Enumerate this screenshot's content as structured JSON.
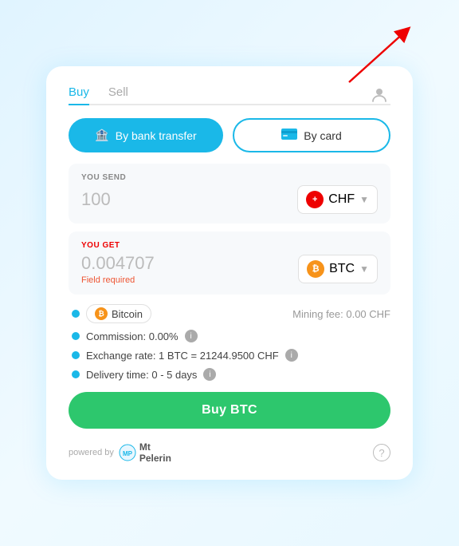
{
  "tabs": {
    "buy_label": "Buy",
    "sell_label": "Sell",
    "active": "buy"
  },
  "payment_methods": {
    "bank_transfer_label": "By bank transfer",
    "card_label": "By card"
  },
  "send_section": {
    "label": "YOU SEND",
    "amount": "100",
    "currency_code": "CHF",
    "currency_symbol": "+"
  },
  "get_section": {
    "label": "YOU GET",
    "amount": "0.004707",
    "currency_code": "BTC",
    "field_required": "Field required"
  },
  "coin_info": {
    "coin_name": "Bitcoin",
    "mining_fee_label": "Mining fee: 0.00 CHF"
  },
  "details": {
    "commission": "Commission: 0.00%",
    "exchange_rate": "Exchange rate: 1 BTC = 21244.9500 CHF",
    "delivery_time": "Delivery time: 0 - 5 days"
  },
  "buy_button_label": "Buy BTC",
  "footer": {
    "powered_by": "powered by",
    "brand": "Mt\nPelerin"
  }
}
